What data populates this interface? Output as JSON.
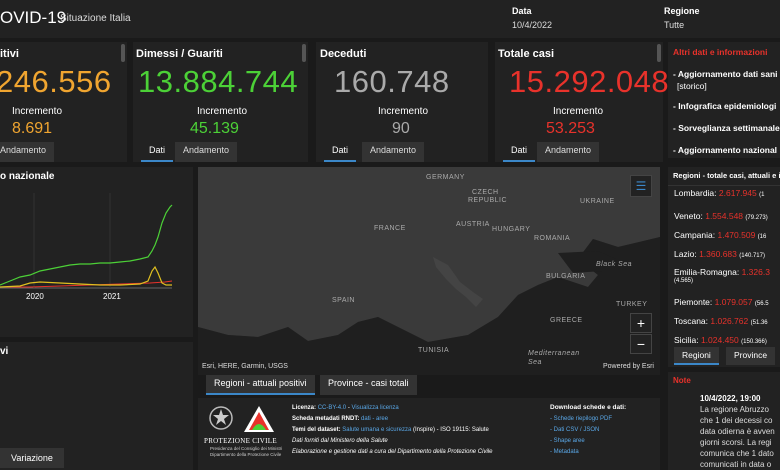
{
  "header": {
    "title": "OVID-19",
    "subtitle": "Situazione Italia",
    "data_label": "Data",
    "data_value": "10/4/2022",
    "regione_label": "Regione",
    "regione_value": "Tutte"
  },
  "kpis": {
    "positivi": {
      "title": "itivi",
      "value": "246.556",
      "inc_label": "Incremento",
      "inc_value": "8.691",
      "color": "#f0a530",
      "tab_label": "Andamento"
    },
    "dimessi": {
      "title": "Dimessi / Guariti",
      "value": "13.884.744",
      "inc_label": "Incremento",
      "inc_value": "45.139",
      "color": "#4cd137",
      "tab_dati": "Dati",
      "tab_andamento": "Andamento"
    },
    "deceduti": {
      "title": "Deceduti",
      "value": "160.748",
      "inc_label": "Incremento",
      "inc_value": "90",
      "color": "#aaaaaa",
      "tab_dati": "Dati",
      "tab_andamento": "Andamento"
    },
    "totale": {
      "title": "Totale casi",
      "value": "15.292.048",
      "inc_label": "Incremento",
      "inc_value": "53.253",
      "color": "#e8322b",
      "tab_dati": "Dati",
      "tab_andamento": "Andamento"
    }
  },
  "altri_dati": {
    "title": "Altri dati e informazioni",
    "items": [
      "- Aggiornamento dati sani",
      "[storico]",
      "- Infografica epidemiologi",
      "- Sorveglianza settimanale",
      "- Aggiornamento nazional"
    ]
  },
  "trend_chart": {
    "title": "o nazionale",
    "x_ticks": [
      "2020",
      "2021"
    ]
  },
  "bottom_left": {
    "title": "vi",
    "variazione_label": "Variazione"
  },
  "map": {
    "labels": [
      "GERMANY",
      "CZECH",
      "REPUBLIC",
      "UKRAINE",
      "AUSTRIA",
      "FRANCE",
      "HUNGARY",
      "ROMANIA",
      "Black Sea",
      "BULGARIA",
      "SPAIN",
      "TURKEY",
      "GREECE",
      "TUNISIA",
      "Mediterranean Sea"
    ],
    "attribution": "Esri, HERE, Garmin, USGS",
    "powered": "Powered by Esri",
    "zoom_in": "+",
    "zoom_out": "−",
    "tab_regioni": "Regioni - attuali positivi",
    "tab_province": "Province - casi totali"
  },
  "footer": {
    "pc_title": "PROTEZIONE CIVILE",
    "pc_sub1": "Presidenza del Consiglio dei Ministri",
    "pc_sub2": "Dipartimento della Protezione Civile",
    "licenza_label": "Licenza:",
    "licenza_value": "CC-BY-4.0",
    "licenza_link": "Visualizza licenza",
    "scheda_label": "Scheda metadati RNDT:",
    "scheda_value": "dati - aree",
    "temi_label": "Temi del dataset:",
    "temi_value": "Salute umana e sicurezza",
    "temi_rest": "(Inspire) - ISO 19115: Salute",
    "fonte": "Dati forniti dal Ministero della Salute",
    "elab": "Elaborazione e gestione dati a cura del Dipartimento della Protezione Civile",
    "download_title": "Download schede e dati:",
    "download_items": [
      "- Schede riepilogo PDF",
      "- Dati CSV / JSON",
      "- Shape aree",
      "- Metadata"
    ]
  },
  "regioni_list": {
    "title": "Regioni - totale casi, attuali e in",
    "rows": [
      {
        "name": "Lombardia:",
        "value": "2.617.945",
        "extra": "(1"
      },
      {
        "name": "Veneto:",
        "value": "1.554.548",
        "extra": "(79.273)"
      },
      {
        "name": "Campania:",
        "value": "1.470.509",
        "extra": "(16"
      },
      {
        "name": "Lazio:",
        "value": "1.360.683",
        "extra": "(140.717)"
      },
      {
        "name": "Emilia-Romagna:",
        "value": "1.326.3",
        "extra": ""
      },
      {
        "name": "(4.565)",
        "value": "",
        "extra": ""
      },
      {
        "name": "Piemonte:",
        "value": "1.079.057",
        "extra": "(56.5"
      },
      {
        "name": "Toscana:",
        "value": "1.026.762",
        "extra": "(51.36"
      },
      {
        "name": "Sicilia:",
        "value": "1.024.450",
        "extra": "(150.366)"
      }
    ],
    "tab_regioni": "Regioni",
    "tab_province": "Province"
  },
  "note": {
    "title": "Note",
    "date": "10/4/2022, 19:00",
    "lines": [
      "La regione Abruzzo",
      "che 1 dei decessi co",
      "data odierna è avven",
      "giorni scorsi. La regi",
      "comunica che 1 dato",
      "comunicati in data o"
    ]
  },
  "colors": {
    "accent": "#3b87c8",
    "green": "#4cd137",
    "red": "#e8322b",
    "orange": "#f0a530",
    "yellow": "#e0c020"
  }
}
